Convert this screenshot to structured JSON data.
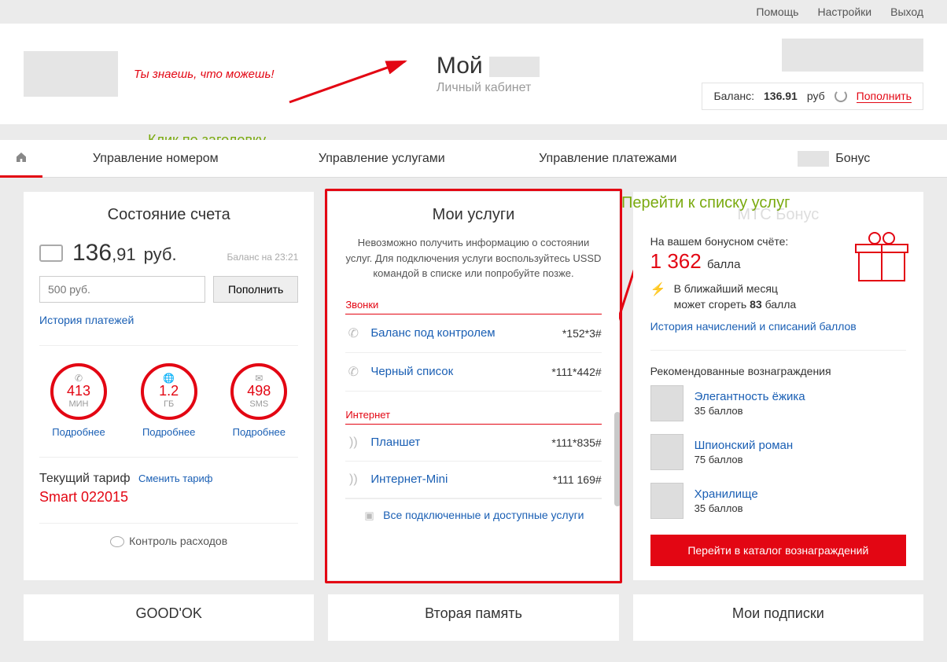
{
  "topnav": {
    "help": "Помощь",
    "settings": "Настройки",
    "logout": "Выход"
  },
  "header": {
    "slogan": "Ты знаешь, что можешь!",
    "brand": "Мой",
    "brand_sub": "Личный кабинет",
    "balance_label": "Баланс:",
    "balance_value": "136.91",
    "balance_cur": "руб",
    "topup": "Пополнить"
  },
  "annotations": {
    "click_header": "Клик по заголовку",
    "goto_services": "Перейти к списку услуг"
  },
  "mainnav": {
    "number": "Управление номером",
    "services": "Управление услугами",
    "payments": "Управление платежами",
    "bonus": "Бонус"
  },
  "account": {
    "title": "Состояние счета",
    "balance_int": "136",
    "balance_dec": ",91",
    "cur": "руб.",
    "ts": "Баланс на 23:21",
    "placeholder": "500 руб.",
    "topup_btn": "Пополнить",
    "history": "История платежей",
    "gauges": [
      {
        "val": "413",
        "unit": "МИН",
        "more": "Подробнее"
      },
      {
        "val": "1.2",
        "unit": "ГБ",
        "more": "Подробнее"
      },
      {
        "val": "498",
        "unit": "SMS",
        "more": "Подробнее"
      }
    ],
    "tariff_lbl": "Текущий тариф",
    "tariff_change": "Сменить тариф",
    "tariff_name": "Smart 022015",
    "expense": "Контроль расходов"
  },
  "services": {
    "title": "Мои услуги",
    "msg": "Невозможно получить информацию о состоянии услуг. Для подключения услуги воспользуйтесь USSD командой в списке или попробуйте позже.",
    "grp_calls": "Звонки",
    "grp_net": "Интернет",
    "items_calls": [
      {
        "name": "Баланс под контролем",
        "code": "*152*3#"
      },
      {
        "name": "Черный список",
        "code": "*111*442#"
      }
    ],
    "items_net": [
      {
        "name": "Планшет",
        "code": "*111*835#"
      },
      {
        "name": "Интернет-Mini",
        "code": "*111 169#"
      }
    ],
    "all": "Все подключенные и доступные услуги"
  },
  "bonus": {
    "title": "МТС Бонус",
    "hdr": "На вашем бонусном счёте:",
    "amount": "1 362",
    "amount_unit": "балла",
    "burn1": "В ближайший месяц",
    "burn2a": "может сгореть ",
    "burn2b": "83",
    "burn2c": " балла",
    "history": "История начислений и списаний баллов",
    "rec_hd": "Рекомендованные вознаграждения",
    "rewards": [
      {
        "name": "Элегантность ёжика",
        "pts": "35 баллов"
      },
      {
        "name": "Шпионский роман",
        "pts": "75 баллов"
      },
      {
        "name": "Хранилище",
        "pts": "35 баллов"
      }
    ],
    "catalog": "Перейти в каталог вознаграждений"
  },
  "bottom": {
    "goodok": "GOOD'OK",
    "memory": "Вторая память",
    "subs": "Мои подписки"
  }
}
